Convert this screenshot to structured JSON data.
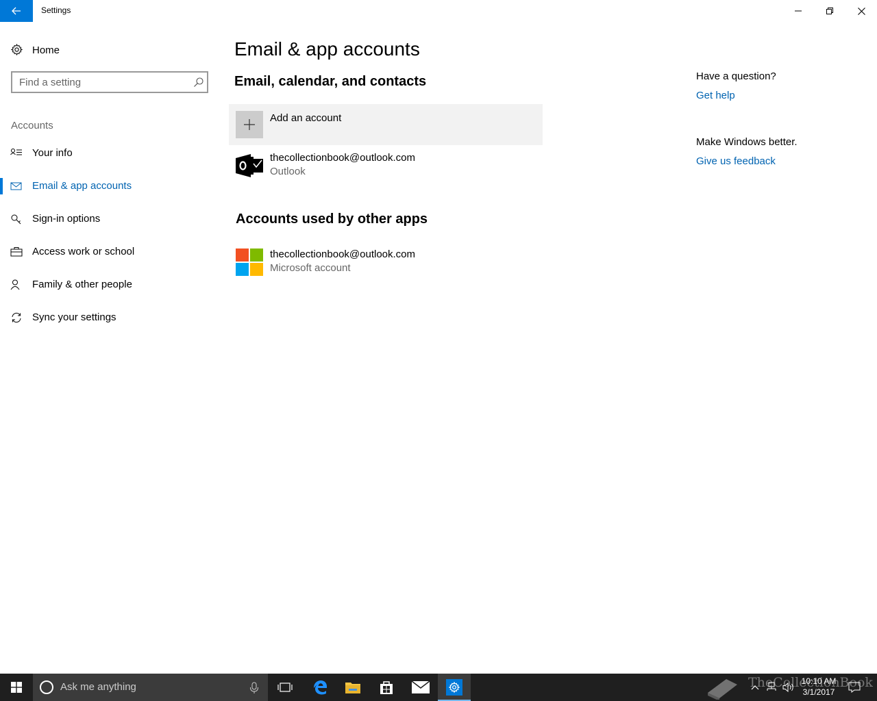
{
  "window": {
    "title": "Settings"
  },
  "sidebar": {
    "home_label": "Home",
    "search_placeholder": "Find a setting",
    "section_label": "Accounts",
    "items": [
      {
        "label": "Your info",
        "icon": "person-card-icon",
        "selected": false
      },
      {
        "label": "Email & app accounts",
        "icon": "mail-icon",
        "selected": true
      },
      {
        "label": "Sign-in options",
        "icon": "key-icon",
        "selected": false
      },
      {
        "label": "Access work or school",
        "icon": "briefcase-icon",
        "selected": false
      },
      {
        "label": "Family & other people",
        "icon": "person-add-icon",
        "selected": false
      },
      {
        "label": "Sync your settings",
        "icon": "sync-icon",
        "selected": false
      }
    ]
  },
  "main": {
    "title": "Email & app accounts",
    "email_section": {
      "heading": "Email, calendar, and contacts",
      "add_account_label": "Add an account",
      "accounts": [
        {
          "email": "thecollectionbook@outlook.com",
          "type": "Outlook",
          "icon": "outlook-icon"
        }
      ]
    },
    "other_apps_section": {
      "heading": "Accounts used by other apps",
      "accounts": [
        {
          "email": "thecollectionbook@outlook.com",
          "type": "Microsoft account",
          "icon": "microsoft-logo-icon"
        }
      ]
    }
  },
  "help_pane": {
    "question": "Have a question?",
    "get_help": "Get help",
    "feedback_prompt": "Make Windows better.",
    "feedback_link": "Give us feedback"
  },
  "taskbar": {
    "search_placeholder": "Ask me anything",
    "clock_time": "10:10 AM",
    "clock_date": "3/1/2017",
    "watermark": "TheCollectionBook"
  },
  "colors": {
    "accent": "#0078d7",
    "link": "#0063b1",
    "taskbar": "#1f1f1f",
    "add_account_bg": "#f2f2f2"
  }
}
